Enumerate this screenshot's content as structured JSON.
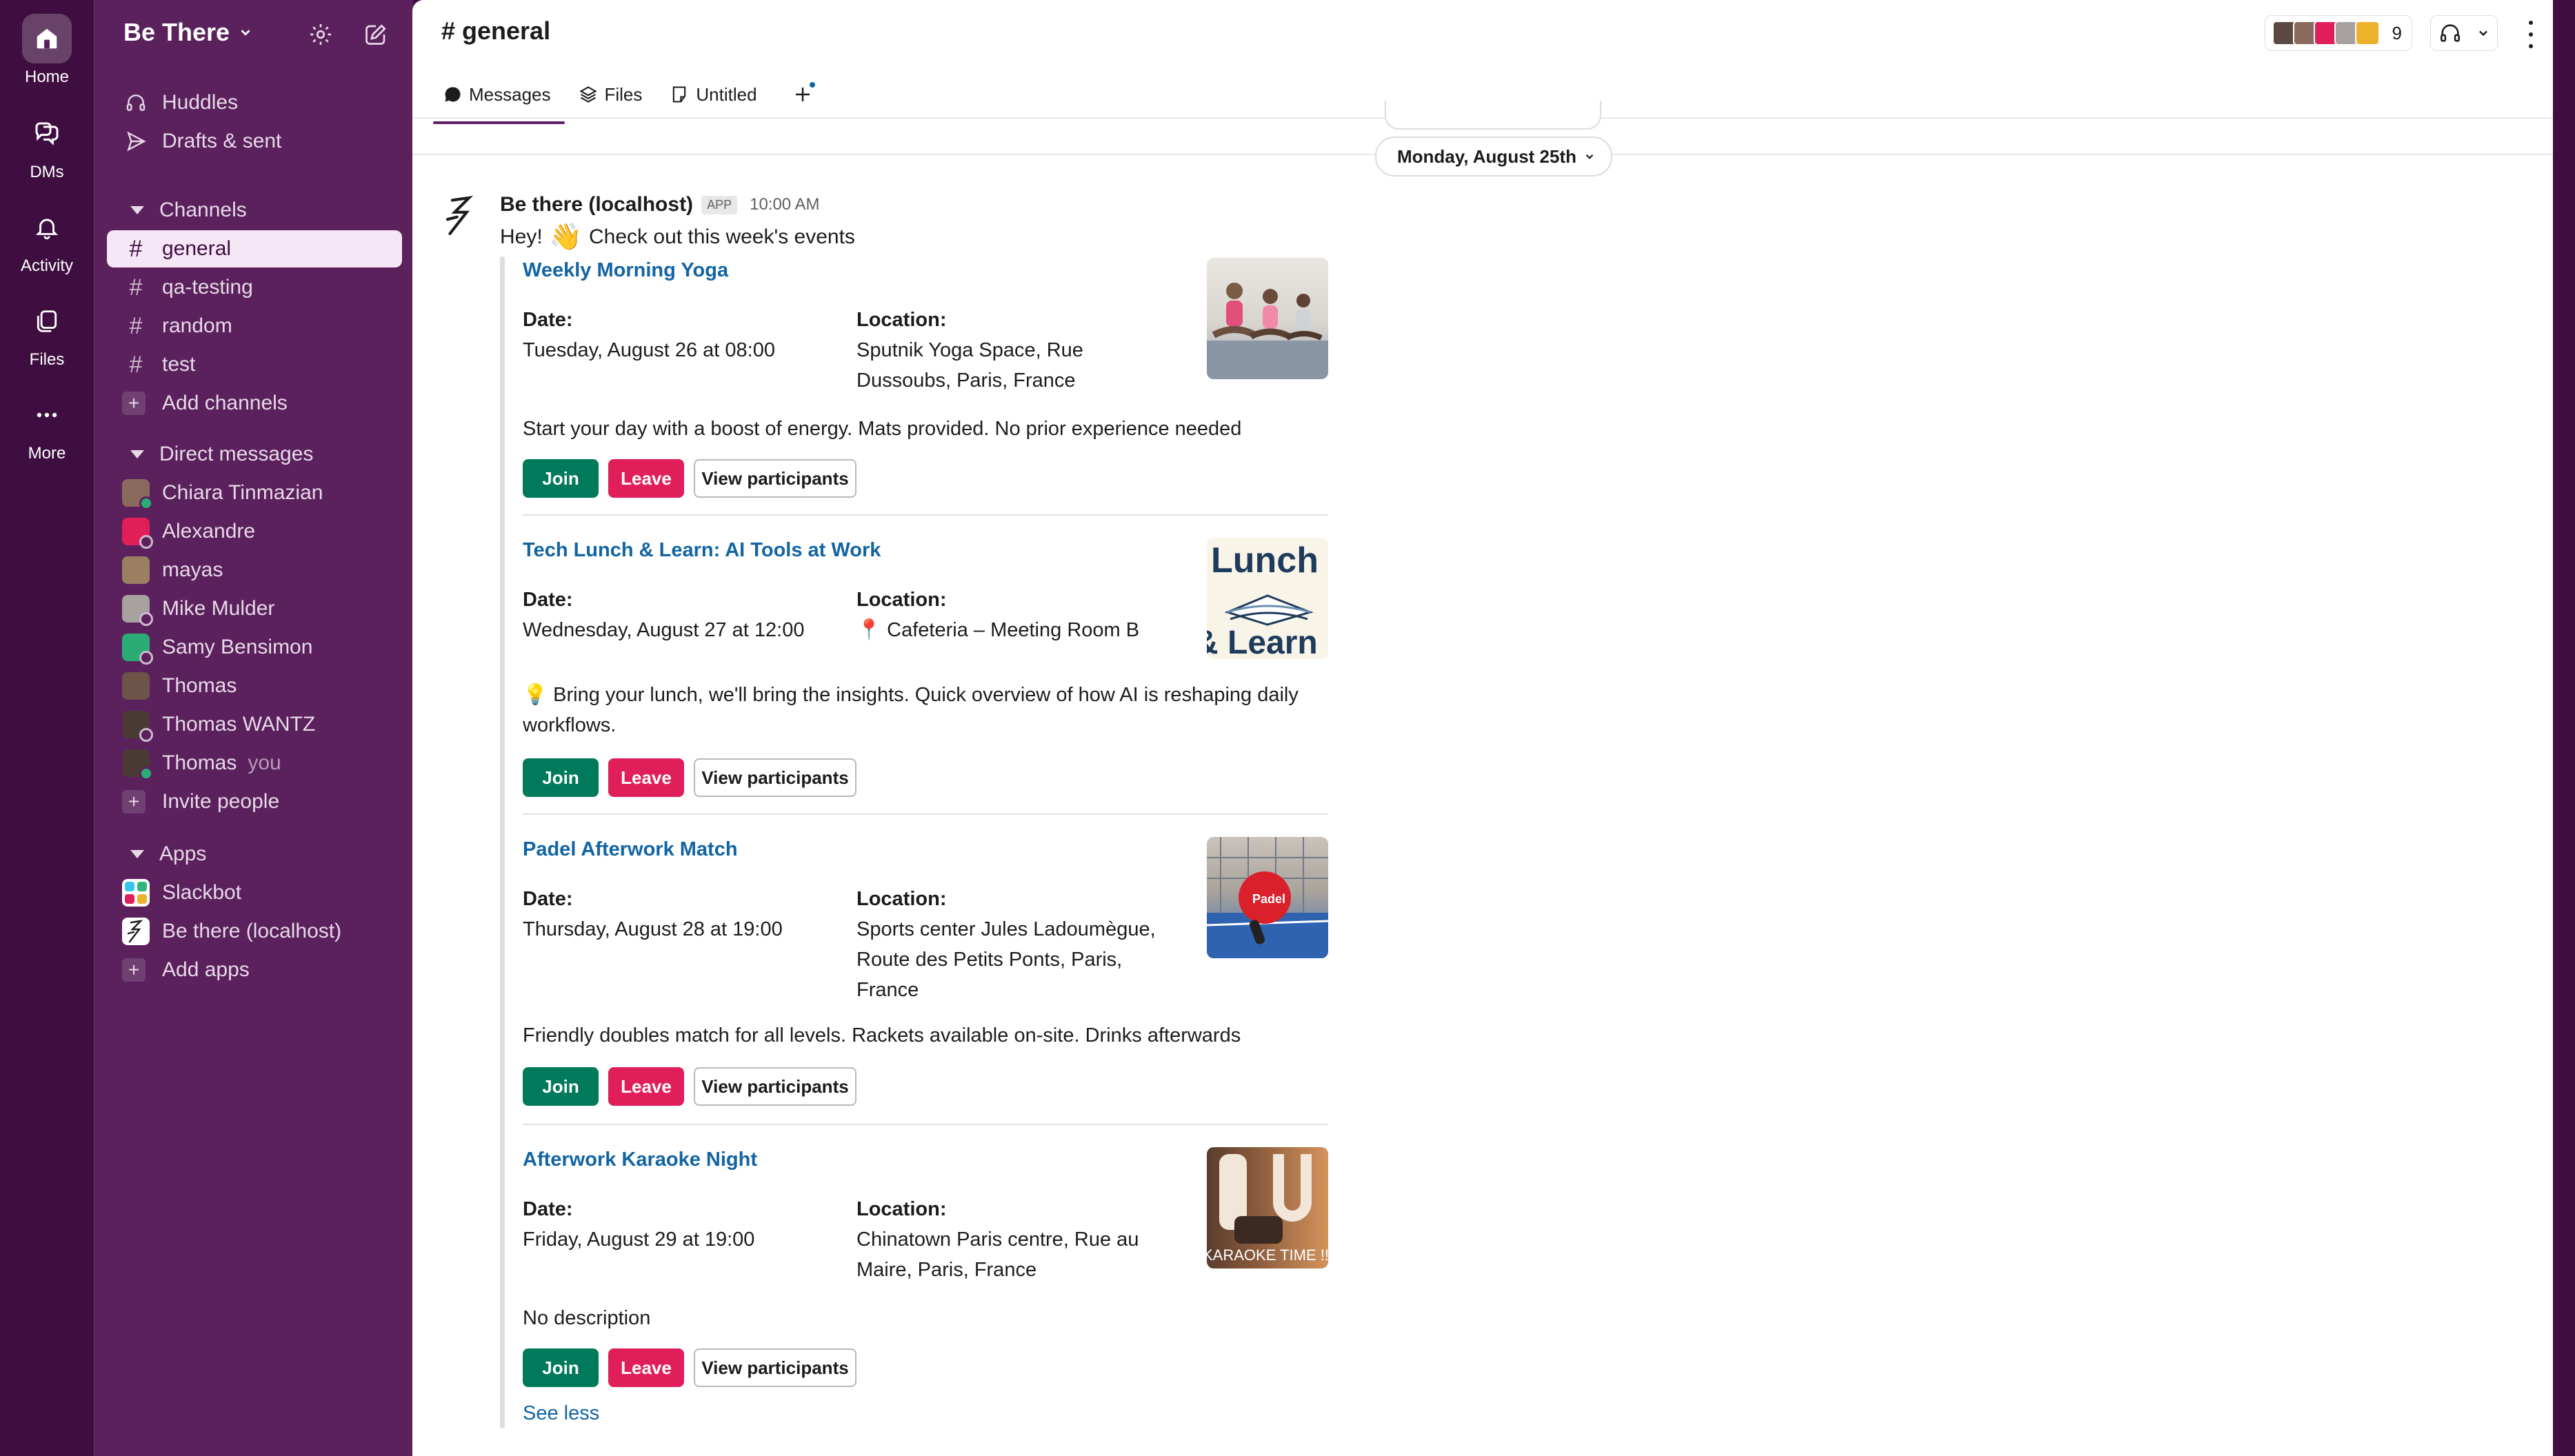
{
  "rail": {
    "items": [
      {
        "label": "Home",
        "icon": "home-icon"
      },
      {
        "label": "DMs",
        "icon": "dms-icon"
      },
      {
        "label": "Activity",
        "icon": "bell-icon"
      },
      {
        "label": "Files",
        "icon": "files-icon"
      },
      {
        "label": "More",
        "icon": "more-icon"
      }
    ]
  },
  "workspace": {
    "name": "Be There"
  },
  "sidebar": {
    "top_items": [
      {
        "label": "Huddles",
        "icon": "headphones-icon"
      },
      {
        "label": "Drafts & sent",
        "icon": "send-icon"
      }
    ],
    "channels_header": "Channels",
    "channels": [
      {
        "label": "general",
        "active": true
      },
      {
        "label": "qa-testing"
      },
      {
        "label": "random"
      },
      {
        "label": "test"
      }
    ],
    "add_channels": "Add channels",
    "dm_header": "Direct messages",
    "dms": [
      {
        "label": "Chiara Tinmazian",
        "color": "#8a6a5c"
      },
      {
        "label": "Alexandre",
        "color": "#e01e5a"
      },
      {
        "label": "mayas",
        "color": "#9b7f62"
      },
      {
        "label": "Mike Mulder",
        "color": "#a7a2a0"
      },
      {
        "label": "Samy Bensimon",
        "color": "#2bac76"
      },
      {
        "label": "Thomas",
        "color": "#6d5348"
      },
      {
        "label": "Thomas WANTZ",
        "color": "#4a3a36"
      },
      {
        "label": "Thomas",
        "color": "#4a3a36",
        "suffix": "you"
      }
    ],
    "invite": "Invite people",
    "apps_header": "Apps",
    "apps": [
      {
        "label": "Slackbot"
      },
      {
        "label": "Be there (localhost)"
      }
    ],
    "add_apps": "Add apps"
  },
  "channel": {
    "title": "# general",
    "member_count": "9",
    "tabs": [
      {
        "label": "Messages",
        "icon": "message-icon"
      },
      {
        "label": "Files",
        "icon": "layers-icon"
      },
      {
        "label": "Untitled",
        "icon": "canvas-icon"
      }
    ]
  },
  "date_divider": "Monday, August 25th",
  "message": {
    "sender": "Be there (localhost)",
    "badge": "APP",
    "time": "10:00 AM",
    "text_before": "Hey!",
    "emoji": "👋",
    "text_after": "Check out this week's events",
    "see_less": "See less"
  },
  "labels": {
    "date": "Date:",
    "location": "Location:",
    "join": "Join",
    "leave": "Leave",
    "view": "View participants"
  },
  "events": [
    {
      "title": "Weekly Morning Yoga",
      "date": "Tuesday, August 26 at 08:00",
      "location": "Sputnik Yoga Space, Rue Dussoubs, Paris, France",
      "description": "Start your day with a boost of energy. Mats provided. No prior experience needed",
      "image": "yoga-image"
    },
    {
      "title": "Tech Lunch & Learn: AI Tools at Work",
      "date": "Wednesday, August 27 at 12:00",
      "location_emoji": "📍",
      "location": "Cafeteria – Meeting Room B",
      "desc_emoji": "💡",
      "description": "Bring your lunch, we'll bring the insights. Quick overview of how AI is reshaping daily workflows.",
      "image": "lunch-learn-image",
      "image_text_1": "Lunch",
      "image_text_2": "& Learn"
    },
    {
      "title": "Padel Afterwork Match",
      "date": "Thursday, August 28 at 19:00",
      "location": "Sports center Jules Ladoumègue, Route des Petits Ponts, Paris, France",
      "description": "Friendly doubles match for all levels. Rackets available on-site. Drinks afterwards",
      "image": "padel-image",
      "image_text": "Padel"
    },
    {
      "title": "Afterwork Karaoke Night",
      "date": "Friday, August 29 at 19:00",
      "location": "Chinatown Paris centre, Rue au Maire, Paris, France",
      "description": "No description",
      "image": "karaoke-image",
      "image_text": "KARAOKE TIME !!"
    }
  ]
}
